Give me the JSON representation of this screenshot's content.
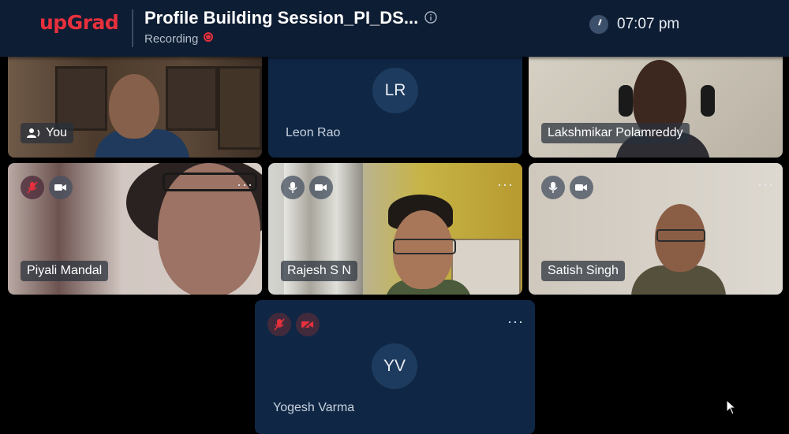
{
  "header": {
    "logo": "upGrad",
    "session_title": "Profile Building Session_PI_DS...",
    "recording_label": "Recording",
    "time": "07:07 pm"
  },
  "participants": [
    {
      "name": "You",
      "has_video": true
    },
    {
      "name": "Leon Rao",
      "initials": "LR",
      "has_video": false
    },
    {
      "name": "Lakshmikar Polamreddy",
      "has_video": true
    },
    {
      "name": "Piyali Mandal",
      "has_video": true,
      "mic": "muted",
      "camera": "on"
    },
    {
      "name": "Rajesh S N",
      "has_video": true,
      "mic": "on",
      "camera": "on"
    },
    {
      "name": "Satish Singh",
      "has_video": true,
      "mic": "on",
      "camera": "on"
    },
    {
      "name": "Yogesh Varma",
      "initials": "YV",
      "has_video": false,
      "mic": "muted",
      "camera": "off"
    }
  ],
  "more_menu_glyph": "···",
  "colors": {
    "header_bg": "#0d1d33",
    "brand_red": "#e8303d",
    "tile_bg": "#0f2745",
    "avatar_bg": "#1d3b5e"
  }
}
